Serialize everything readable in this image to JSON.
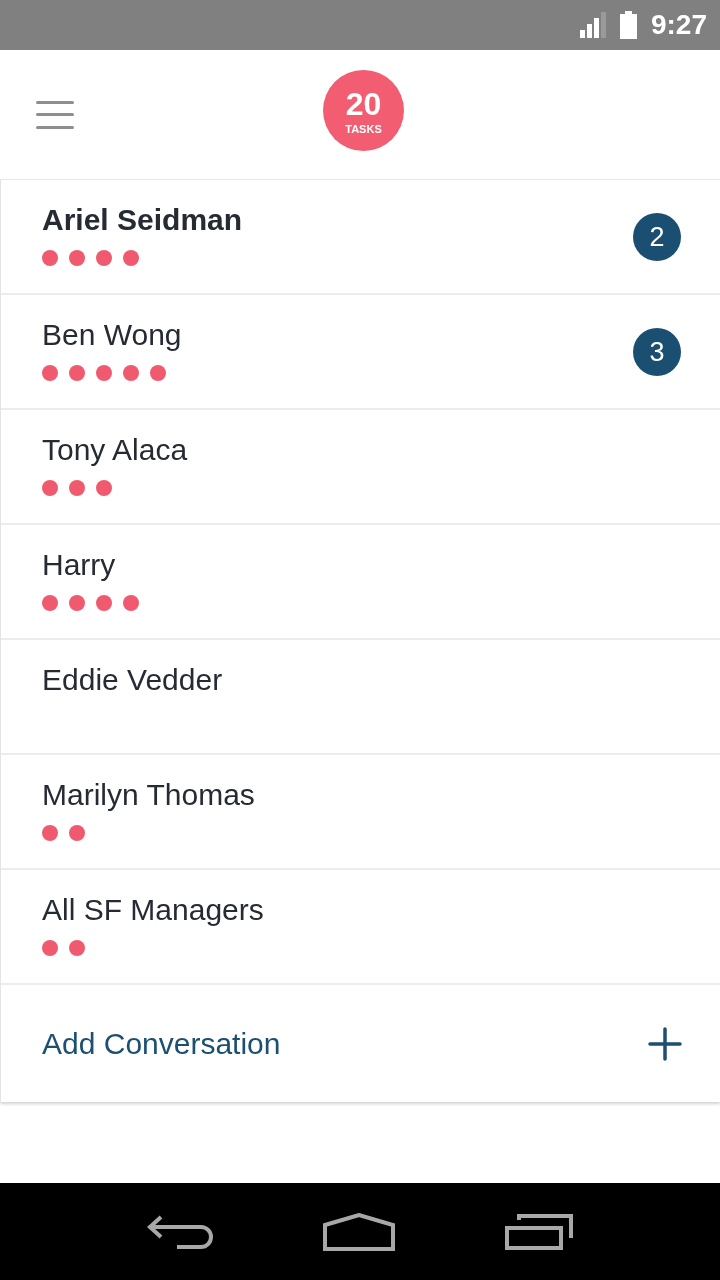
{
  "status_bar": {
    "time": "9:27"
  },
  "header": {
    "task_count": "20",
    "task_label": "TASKS"
  },
  "conversations": [
    {
      "name": "Ariel Seidman",
      "unread": true,
      "task_dots": [
        {
          "color": "#f05a6e"
        },
        {
          "color": "#f05a6e"
        },
        {
          "color": "#f05a6e"
        },
        {
          "color": "#f05a6e"
        }
      ],
      "badge": "2"
    },
    {
      "name": "Ben Wong",
      "unread": false,
      "task_dots": [
        {
          "color": "#f05a6e"
        },
        {
          "color": "#f05a6e"
        },
        {
          "color": "#f05a6e"
        },
        {
          "color": "#f05a6e"
        },
        {
          "color": "#f05a6e"
        }
      ],
      "badge": "3"
    },
    {
      "name": "Tony Alaca",
      "unread": false,
      "task_dots": [
        {
          "color": "#f05a6e"
        },
        {
          "color": "#f05a6e"
        },
        {
          "color": "#f05a6e"
        }
      ]
    },
    {
      "name": "Harry",
      "unread": false,
      "task_dots": [
        {
          "color": "#f05a6e"
        },
        {
          "color": "#f05a6e"
        },
        {
          "color": "#f05a6e"
        },
        {
          "color": "#f05a6e"
        }
      ]
    },
    {
      "name": "Eddie Vedder",
      "unread": false
    },
    {
      "name": "Marilyn Thomas",
      "unread": false,
      "task_dots": [
        {
          "color": "#f05a6e"
        },
        {
          "color": "#f05a6e"
        }
      ]
    },
    {
      "name": "All SF Managers",
      "unread": false,
      "task_dots": [
        {
          "color": "#f05a6e"
        },
        {
          "color": "#f05a6e"
        }
      ]
    }
  ],
  "add_conversation": {
    "label": "Add Conversation"
  }
}
